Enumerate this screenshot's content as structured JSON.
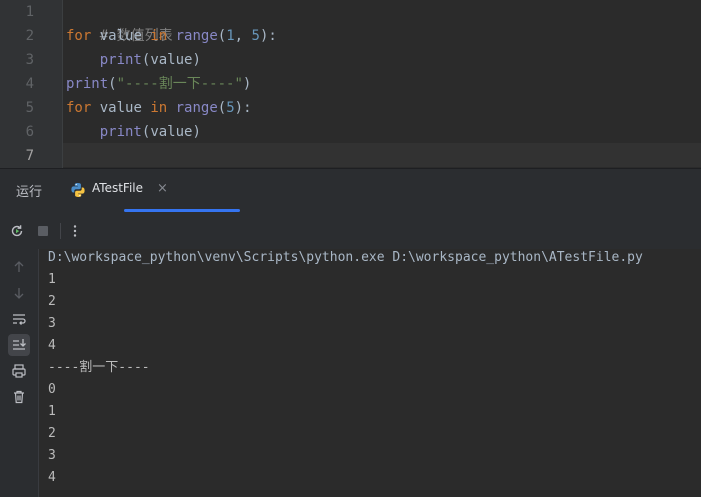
{
  "editor": {
    "line_numbers": [
      "1",
      "2",
      "3",
      "4",
      "5",
      "6",
      "7"
    ],
    "line1": {
      "comment": "# 数值列表"
    },
    "line2": {
      "kw_for": "for",
      "var": " value ",
      "kw_in": "in",
      "sp": " ",
      "fn": "range",
      "open": "(",
      "n1": "1",
      "comma": ", ",
      "n2": "5",
      "close": "):"
    },
    "line3": {
      "indent": "    ",
      "fn": "print",
      "open": "(",
      "arg": "value",
      "close": ")"
    },
    "line4": {
      "fn": "print",
      "open": "(",
      "str": "\"----割一下----\"",
      "close": ")"
    },
    "line5": {
      "kw_for": "for",
      "var": " value ",
      "kw_in": "in",
      "sp": " ",
      "fn": "range",
      "open": "(",
      "n1": "5",
      "close": "):"
    },
    "line6": {
      "indent": "    ",
      "fn": "print",
      "open": "(",
      "arg": "value",
      "close": ")"
    }
  },
  "run_window": {
    "tab_run_label": "运行",
    "tab_file_label": "ATestFile",
    "tab_close": "×",
    "command": "D:\\workspace_python\\venv\\Scripts\\python.exe D:\\workspace_python\\ATestFile.py",
    "output": [
      "1",
      "2",
      "3",
      "4",
      "----割一下----",
      "0",
      "1",
      "2",
      "3",
      "4"
    ]
  },
  "icons": {
    "rerun": "rerun-icon",
    "stop": "stop-icon",
    "more": "more-vertical-icon",
    "up": "arrow-up-icon",
    "down": "arrow-down-icon",
    "wrap": "soft-wrap-icon",
    "scroll_end": "scroll-to-end-icon",
    "print": "print-icon",
    "trash": "trash-icon"
  },
  "colors": {
    "keyword": "#cc7832",
    "builtin": "#8888c6",
    "number": "#6897bb",
    "string": "#6a8759",
    "comment": "#808080",
    "accent": "#3574f0"
  }
}
